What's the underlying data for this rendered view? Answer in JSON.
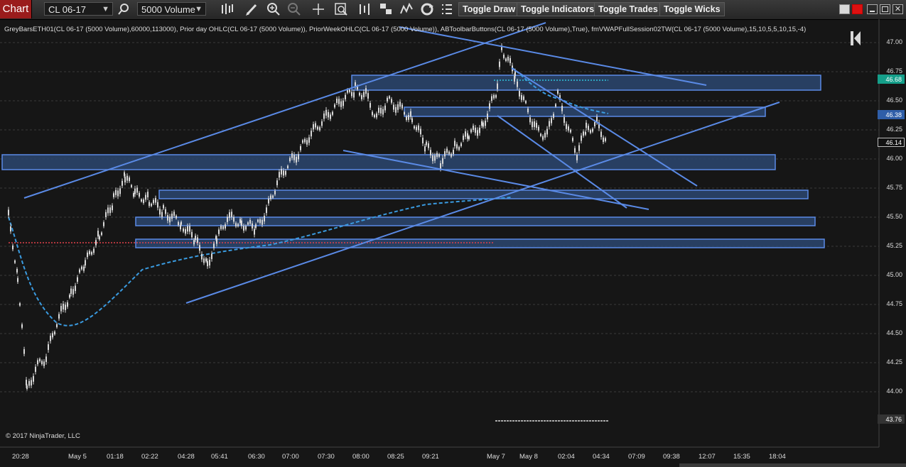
{
  "toolbar": {
    "chart_tab": "Chart",
    "instrument": "CL 06-17",
    "period": "5000 Volume",
    "buttons": [
      "Toggle Draw",
      "Toggle Indicators",
      "Toggle Trades",
      "Toggle Wicks"
    ],
    "icons": [
      "search-icon",
      "candlestick-icon",
      "pencil-icon",
      "zoom-in-icon",
      "zoom-out-icon",
      "crosshair-icon",
      "data-box-icon",
      "bar-spacing-icon",
      "drawing-objects-icon",
      "strategy-icon",
      "refresh-icon",
      "properties-icon"
    ]
  },
  "chart": {
    "indicator_label": "GreyBarsETH01(CL 06-17 (5000 Volume),60000,113000), Prior day OHLC(CL 06-17 (5000 Volume)), PriorWeekOHLC(CL 06-17 (5000 Volume)), ABToolbarButtons(CL 06-17 (5000 Volume),True), fmVWAPFullSession02TW(CL 06-17 (5000 Volume),15,10,5,5,10,15,-4)",
    "copyright": "© 2017 NinjaTrader, LLC",
    "y_ticks": [
      "47.00",
      "46.75",
      "46.50",
      "46.25",
      "46.00",
      "45.75",
      "45.50",
      "45.25",
      "45.00",
      "44.75",
      "44.50",
      "44.25",
      "44.00"
    ],
    "x_ticks": [
      "20:28",
      "May 5",
      "01:18",
      "02:22",
      "04:28",
      "05:41",
      "06:30",
      "07:00",
      "07:30",
      "08:00",
      "08:25",
      "09:21",
      "May 7",
      "May 8",
      "02:04",
      "04:34",
      "07:09",
      "09:38",
      "12:07",
      "15:35",
      "18:04"
    ],
    "price_flags": [
      {
        "text": "46.68",
        "color": "#159f8a"
      },
      {
        "text": "46.38",
        "color": "#2f5ea8"
      },
      {
        "text": "46.14",
        "color": "#111111"
      },
      {
        "text": "43.76",
        "color": "#333333"
      }
    ],
    "colors": {
      "zone_fill": "#2c4770",
      "zone_border": "#5a8ae6",
      "trend": "#5a8ae6",
      "vwap": "#3a9be0",
      "prior_line": "#e0404a",
      "bars": "#d8d8d8"
    }
  },
  "chart_data": {
    "type": "candlestick",
    "title": "",
    "symbol": "CL 06-17",
    "period": "5000 Volume",
    "ylim": [
      43.76,
      47.15
    ],
    "grid": true,
    "last_price": 46.14,
    "notes": [
      "Blue rectangle zones near 46.62, 46.40, 45.97, 45.71, 45.48, 45.26",
      "Dashed VWAP line",
      "Red dotted prior-day level near 45.28"
    ]
  }
}
